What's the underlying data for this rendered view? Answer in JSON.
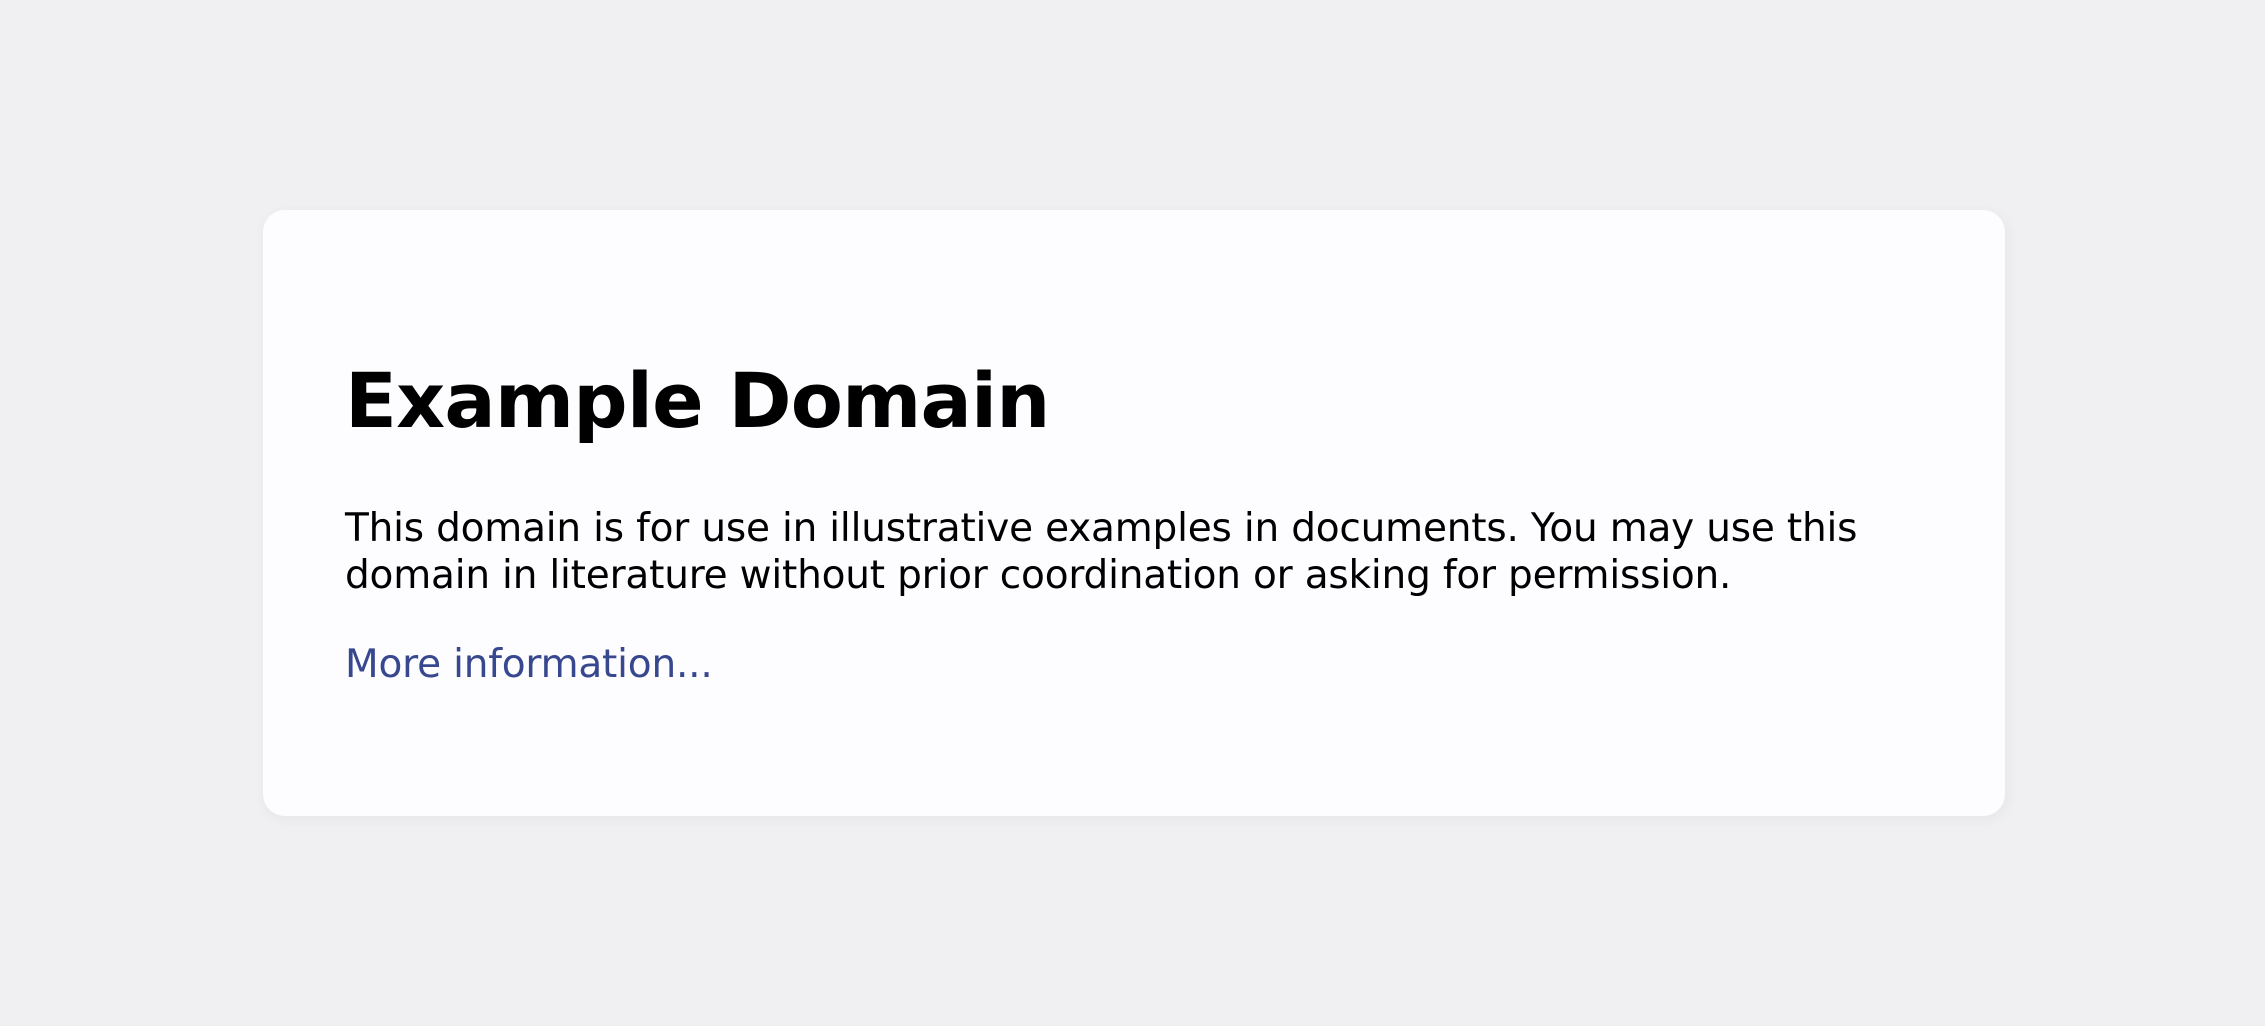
{
  "page": {
    "title": "Example Domain",
    "description": "This domain is for use in illustrative examples in documents. You may use this domain in literature without prior coordination or asking for permission.",
    "link_text": "More information..."
  },
  "colors": {
    "background": "#f0f0f2",
    "card": "#fdfdff",
    "text": "#000000",
    "link": "#38488f"
  }
}
